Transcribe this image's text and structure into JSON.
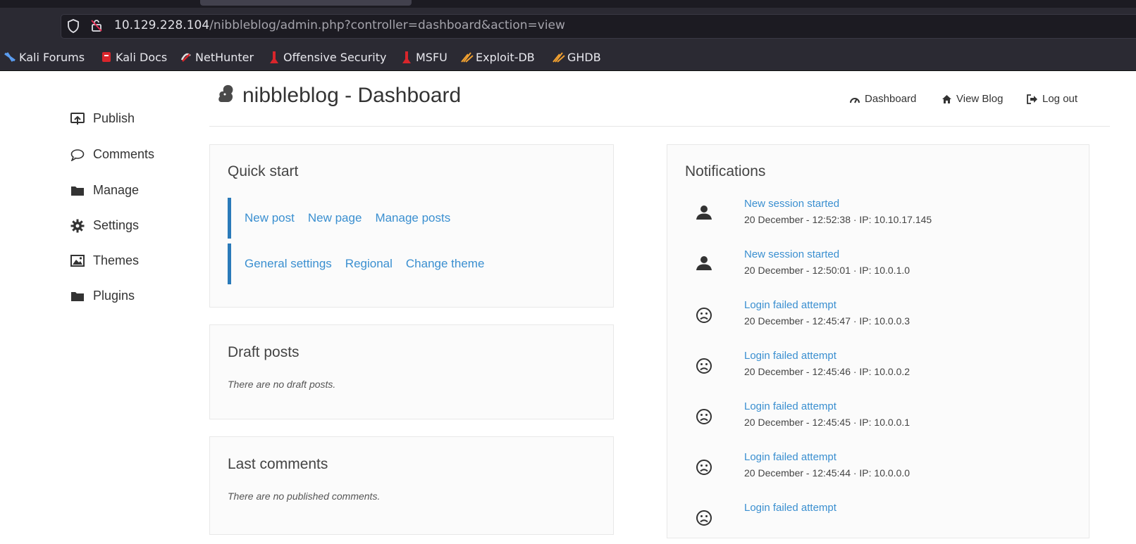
{
  "browser": {
    "url_host": "10.129.228.104",
    "url_path": "/nibbleblog/admin.php?controller=dashboard&action=view",
    "bookmarks": [
      {
        "label": "Kali Forums",
        "icon": "kali-forums-icon"
      },
      {
        "label": "Kali Docs",
        "icon": "kali-docs-icon"
      },
      {
        "label": "NetHunter",
        "icon": "nethunter-icon"
      },
      {
        "label": "Offensive Security",
        "icon": "offsec-icon"
      },
      {
        "label": "MSFU",
        "icon": "msfu-icon"
      },
      {
        "label": "Exploit-DB",
        "icon": "exploit-db-icon"
      },
      {
        "label": "GHDB",
        "icon": "ghdb-icon"
      }
    ]
  },
  "sidebar": {
    "items": [
      {
        "label": "Publish",
        "icon": "publish-icon"
      },
      {
        "label": "Comments",
        "icon": "comment-icon"
      },
      {
        "label": "Manage",
        "icon": "folder-icon"
      },
      {
        "label": "Settings",
        "icon": "gear-icon"
      },
      {
        "label": "Themes",
        "icon": "image-icon"
      },
      {
        "label": "Plugins",
        "icon": "folder-icon"
      }
    ]
  },
  "header": {
    "title": "nibbleblog - Dashboard",
    "nav": [
      {
        "label": "Dashboard",
        "icon": "gauge-icon"
      },
      {
        "label": "View Blog",
        "icon": "home-icon"
      },
      {
        "label": "Log out",
        "icon": "logout-icon"
      }
    ]
  },
  "quick_start": {
    "title": "Quick start",
    "row1": [
      "New post",
      "New page",
      "Manage posts"
    ],
    "row2": [
      "General settings",
      "Regional",
      "Change theme"
    ]
  },
  "drafts": {
    "title": "Draft posts",
    "empty": "There are no draft posts."
  },
  "comments": {
    "title": "Last comments",
    "empty": "There are no published comments."
  },
  "notifications": {
    "title": "Notifications",
    "items": [
      {
        "title": "New session started",
        "detail": "20 December - 12:52:38 · IP: 10.10.17.145",
        "icon": "user-icon"
      },
      {
        "title": "New session started",
        "detail": "20 December - 12:50:01 · IP: 10.0.1.0",
        "icon": "user-icon"
      },
      {
        "title": "Login failed attempt",
        "detail": "20 December - 12:45:47 · IP: 10.0.0.3",
        "icon": "sad-face-icon"
      },
      {
        "title": "Login failed attempt",
        "detail": "20 December - 12:45:46 · IP: 10.0.0.2",
        "icon": "sad-face-icon"
      },
      {
        "title": "Login failed attempt",
        "detail": "20 December - 12:45:45 · IP: 10.0.0.1",
        "icon": "sad-face-icon"
      },
      {
        "title": "Login failed attempt",
        "detail": "20 December - 12:45:44 · IP: 10.0.0.0",
        "icon": "sad-face-icon"
      },
      {
        "title": "Login failed attempt",
        "detail": "",
        "icon": "sad-face-icon"
      }
    ]
  },
  "colors": {
    "link": "#3a8fd0",
    "accent_bar": "#2a7ab9",
    "chrome_bg": "#2b2a33"
  }
}
